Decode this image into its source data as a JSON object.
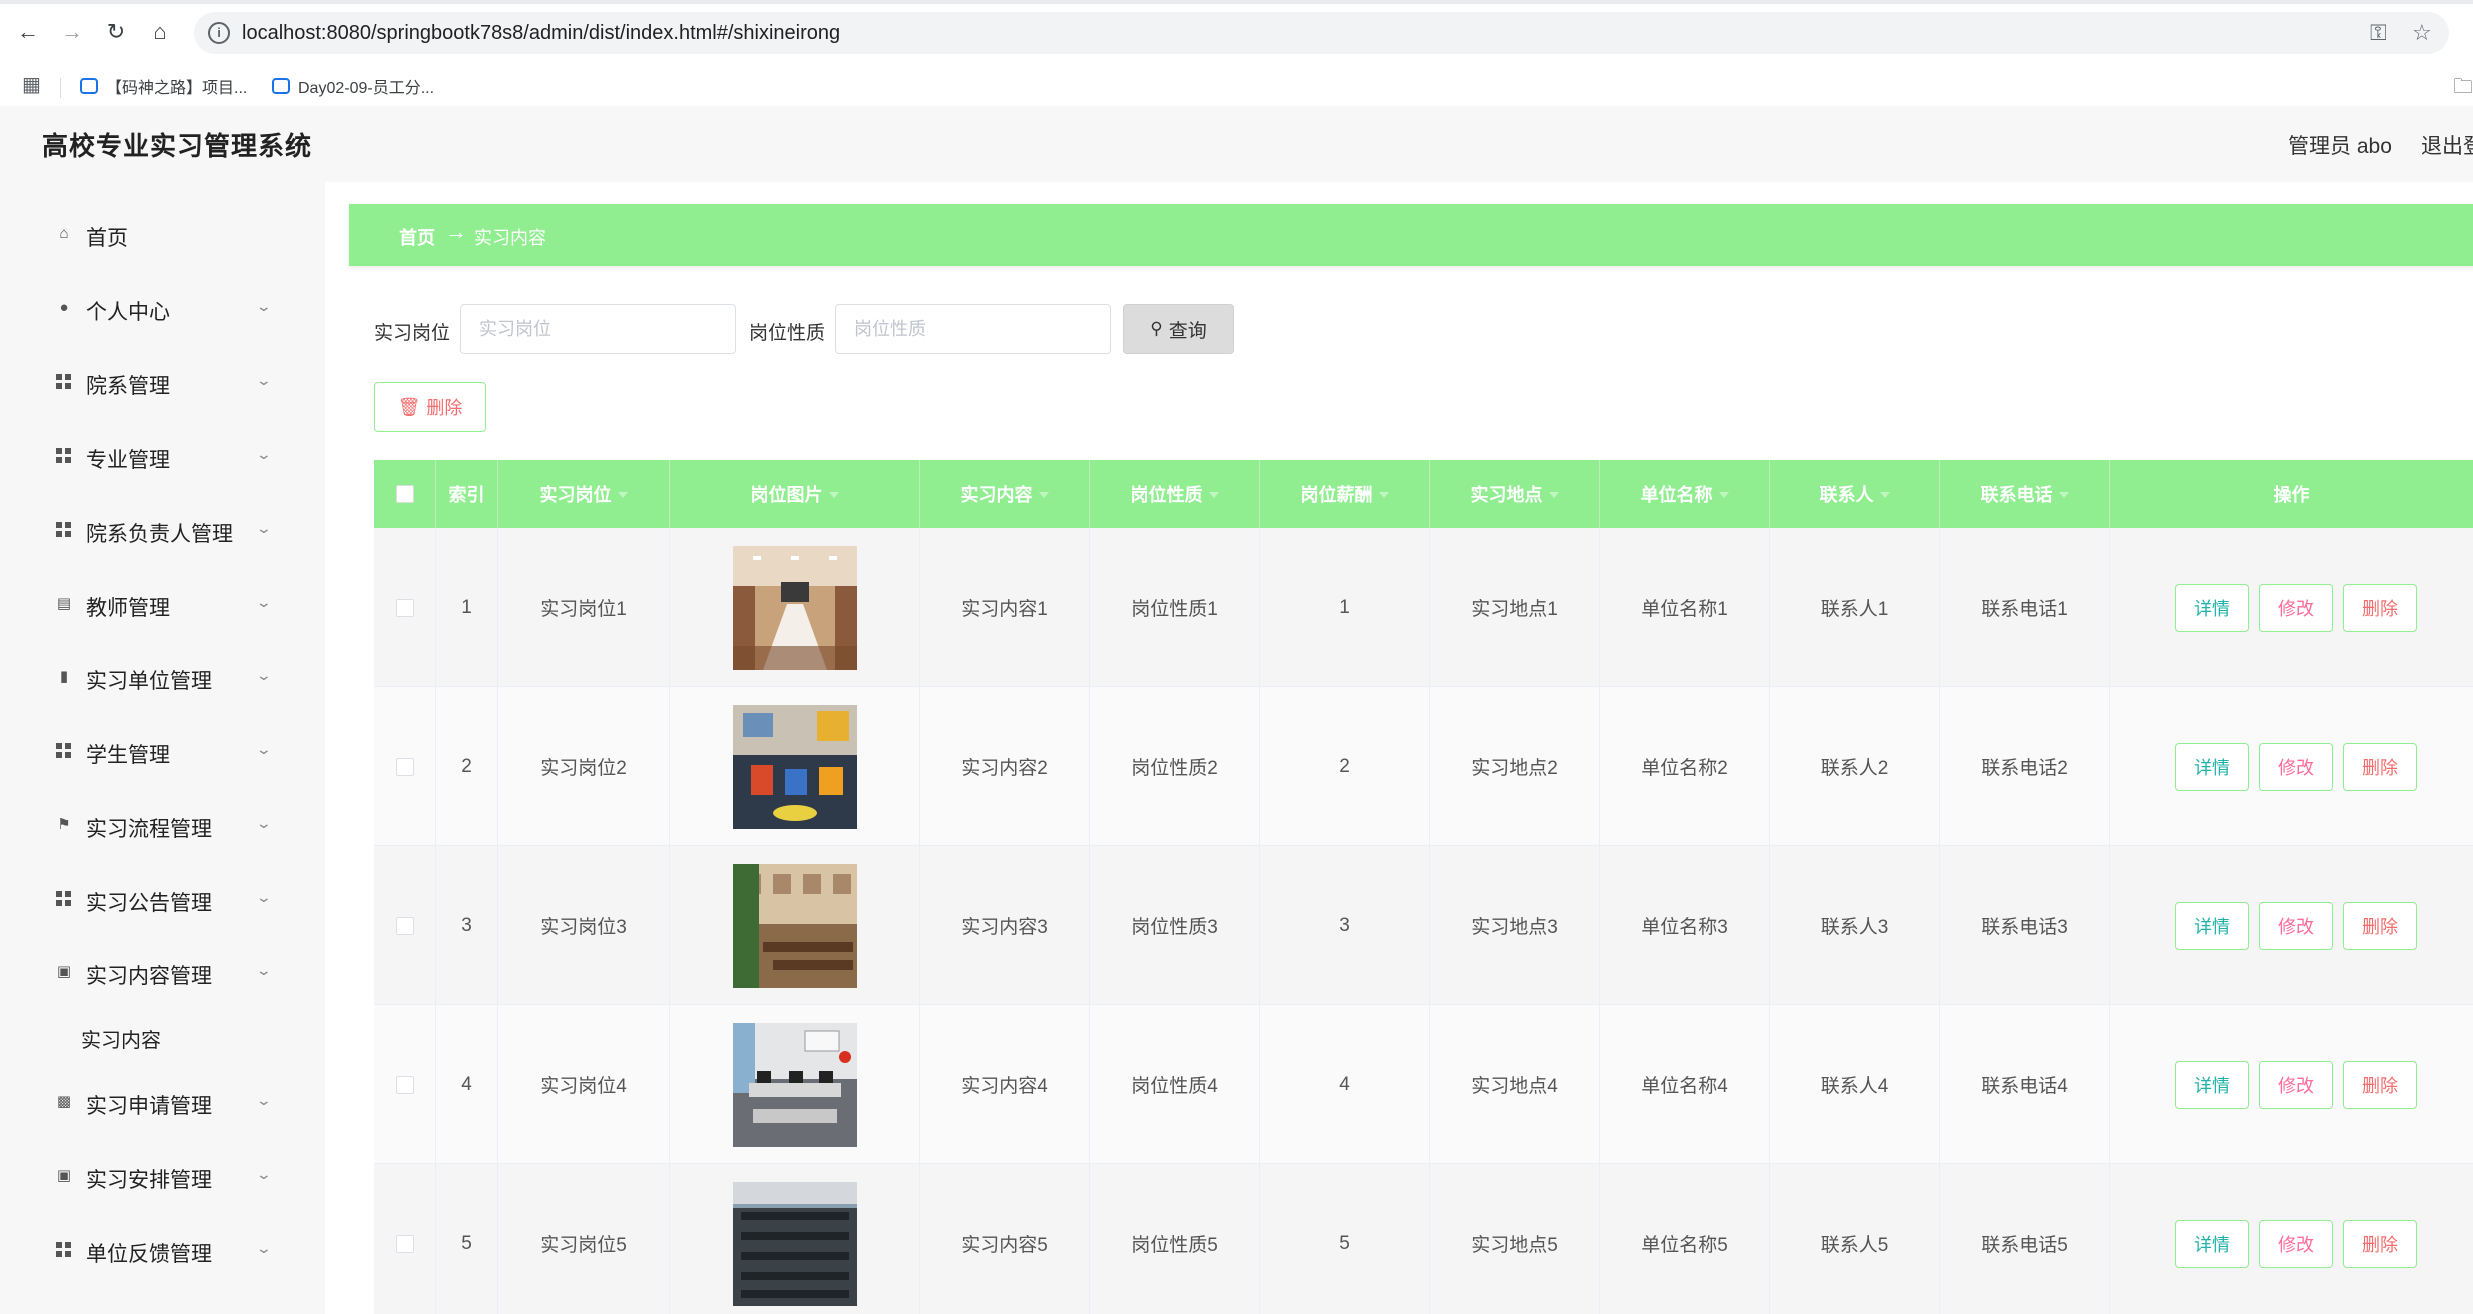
{
  "browser": {
    "url": "localhost:8080/springbootk78s8/admin/dist/index.html#/shixineirong",
    "bookmarks": [
      {
        "label": "【码神之路】项目..."
      },
      {
        "label": "Day02-09-员工分..."
      }
    ],
    "icons": {
      "back": "arrow-left-icon",
      "forward": "arrow-right-icon",
      "reload": "reload-icon",
      "home": "home-icon",
      "key": "key-icon",
      "star": "star-icon",
      "apps": "apps-grid-icon",
      "folder": "folder-icon"
    }
  },
  "header": {
    "title": "高校专业实习管理系统",
    "admin": "管理员 abo",
    "logout": "退出登"
  },
  "sidebar": {
    "items": [
      {
        "label": "首页",
        "icon": "home-icon",
        "expandable": false
      },
      {
        "label": "个人中心",
        "icon": "user-icon",
        "expandable": true
      },
      {
        "label": "院系管理",
        "icon": "grid-icon",
        "expandable": true
      },
      {
        "label": "专业管理",
        "icon": "grid-icon",
        "expandable": true
      },
      {
        "label": "院系负责人管理",
        "icon": "grid-icon",
        "expandable": true
      },
      {
        "label": "教师管理",
        "icon": "chart-icon",
        "expandable": true
      },
      {
        "label": "实习单位管理",
        "icon": "ticket-icon",
        "expandable": true
      },
      {
        "label": "学生管理",
        "icon": "grid-icon",
        "expandable": true
      },
      {
        "label": "实习流程管理",
        "icon": "flag-icon",
        "expandable": true
      },
      {
        "label": "实习公告管理",
        "icon": "grid-icon",
        "expandable": true
      },
      {
        "label": "实习内容管理",
        "icon": "clipboard-icon",
        "expandable": true
      },
      {
        "label": "实习申请管理",
        "icon": "bar-chart-icon",
        "expandable": true
      },
      {
        "label": "实习安排管理",
        "icon": "clipboard-icon",
        "expandable": true
      },
      {
        "label": "单位反馈管理",
        "icon": "grid-icon",
        "expandable": true
      }
    ],
    "subitem": "实习内容"
  },
  "breadcrumb": {
    "home": "首页",
    "current": "实习内容"
  },
  "search": {
    "field1_label": "实习岗位",
    "field1_placeholder": "实习岗位",
    "field2_label": "岗位性质",
    "field2_placeholder": "岗位性质",
    "query_button": "查询"
  },
  "toolbar": {
    "delete_button": "删除"
  },
  "table": {
    "headers": [
      "索引",
      "实习岗位",
      "岗位图片",
      "实习内容",
      "岗位性质",
      "岗位薪酬",
      "实习地点",
      "单位名称",
      "联系人",
      "联系电话",
      "操作"
    ],
    "rows": [
      {
        "index": "1",
        "position": "实习岗位1",
        "content": "实习内容1",
        "nature": "岗位性质1",
        "salary": "1",
        "location": "实习地点1",
        "company": "单位名称1",
        "contact": "联系人1",
        "phone": "联系电话1"
      },
      {
        "index": "2",
        "position": "实习岗位2",
        "content": "实习内容2",
        "nature": "岗位性质2",
        "salary": "2",
        "location": "实习地点2",
        "company": "单位名称2",
        "contact": "联系人2",
        "phone": "联系电话2"
      },
      {
        "index": "3",
        "position": "实习岗位3",
        "content": "实习内容3",
        "nature": "岗位性质3",
        "salary": "3",
        "location": "实习地点3",
        "company": "单位名称3",
        "contact": "联系人3",
        "phone": "联系电话3"
      },
      {
        "index": "4",
        "position": "实习岗位4",
        "content": "实习内容4",
        "nature": "岗位性质4",
        "salary": "4",
        "location": "实习地点4",
        "company": "单位名称4",
        "contact": "联系人4",
        "phone": "联系电话4"
      },
      {
        "index": "5",
        "position": "实习岗位5",
        "content": "实习内容5",
        "nature": "岗位性质5",
        "salary": "5",
        "location": "实习地点5",
        "company": "单位名称5",
        "contact": "联系人5",
        "phone": "联系电话5"
      }
    ],
    "actions": {
      "detail": "详情",
      "edit": "修改",
      "delete": "删除"
    }
  },
  "colors": {
    "accent_green": "#90ee90",
    "detail_text": "#20b2aa",
    "edit_text": "#ff6b9a",
    "delete_text": "#f56c6c"
  }
}
